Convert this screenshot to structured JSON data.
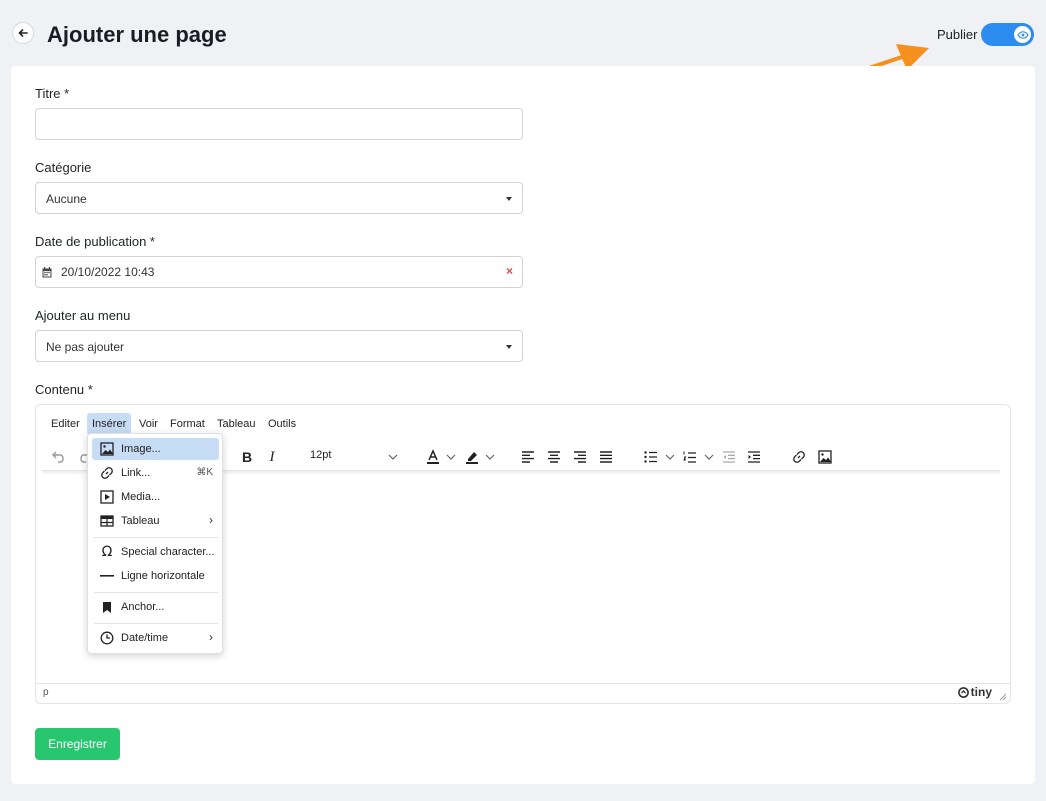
{
  "header": {
    "title": "Ajouter une page",
    "publish_label": "Publier",
    "publish_toggle_on": true
  },
  "form": {
    "title_label": "Titre *",
    "title_value": "",
    "category_label": "Catégorie",
    "category_value": "Aucune",
    "date_label": "Date de publication *",
    "date_value": "20/10/2022 10:43",
    "date_clear": "×",
    "menu_label": "Ajouter au menu",
    "menu_value": "Ne pas ajouter",
    "content_label": "Contenu *",
    "save_label": "Enregistrer"
  },
  "editor": {
    "menubar": [
      "Editer",
      "Insérer",
      "Voir",
      "Format",
      "Tableau",
      "Outils"
    ],
    "active_menu": "Insérer",
    "font_size": "12pt",
    "status_path": "p",
    "brand": "tiny",
    "insert_menu": [
      {
        "label": "Image...",
        "icon": "image-icon"
      },
      {
        "label": "Link...",
        "icon": "link-icon",
        "shortcut": "⌘K"
      },
      {
        "label": "Media...",
        "icon": "media-icon"
      },
      {
        "label": "Tableau",
        "icon": "table-icon",
        "submenu": "›"
      },
      {
        "label": "Special character...",
        "icon": "omega-icon"
      },
      {
        "label": "Ligne horizontale",
        "icon": "horizontal-line-icon"
      },
      {
        "label": "Anchor...",
        "icon": "bookmark-icon"
      },
      {
        "label": "Date/time",
        "icon": "clock-icon",
        "submenu": "›"
      }
    ]
  },
  "colors": {
    "accent": "#2d8cf0",
    "save": "#28c76f",
    "arrow": "#f5901e"
  }
}
